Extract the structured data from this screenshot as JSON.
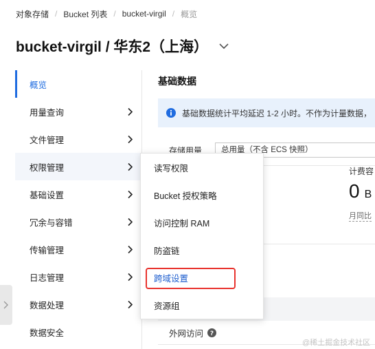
{
  "breadcrumb": {
    "items": [
      "对象存储",
      "Bucket 列表",
      "bucket-virgil"
    ],
    "current": "概览"
  },
  "header": {
    "title": "bucket-virgil / 华东2（上海）",
    "dropdown_icon": "chevron-down-icon"
  },
  "sidebar": {
    "items": [
      {
        "label": "概览",
        "active": true,
        "has_arrow": false
      },
      {
        "label": "用量查询",
        "has_arrow": true
      },
      {
        "label": "文件管理",
        "has_arrow": true
      },
      {
        "label": "权限管理",
        "has_arrow": true,
        "open": true
      },
      {
        "label": "基础设置",
        "has_arrow": true
      },
      {
        "label": "冗余与容错",
        "has_arrow": true
      },
      {
        "label": "传输管理",
        "has_arrow": true
      },
      {
        "label": "日志管理",
        "has_arrow": true
      },
      {
        "label": "数据处理",
        "has_arrow": true
      },
      {
        "label": "数据安全",
        "has_arrow": false
      }
    ]
  },
  "submenu": {
    "parent": "权限管理",
    "items": [
      "读写权限",
      "Bucket 授权策略",
      "访问控制 RAM",
      "防盗链",
      "跨域设置",
      "资源组"
    ],
    "highlighted": "跨域设置"
  },
  "main": {
    "section_title": "基础数据",
    "notice": "基础数据统计平均延迟 1-2 小时。不作为计量数据，",
    "storage_label": "存储用量",
    "storage_select": "总用量（不含 ECS 快照）",
    "metric": {
      "label": "计费容",
      "value": "0",
      "unit": "B",
      "sub": "月同比"
    },
    "row_label": "外网访问"
  },
  "watermark": "@稀土掘金技术社区",
  "colors": {
    "accent": "#1f6ce0",
    "highlight_box": "#e8322d",
    "notice_bg": "#e8f1fc"
  }
}
